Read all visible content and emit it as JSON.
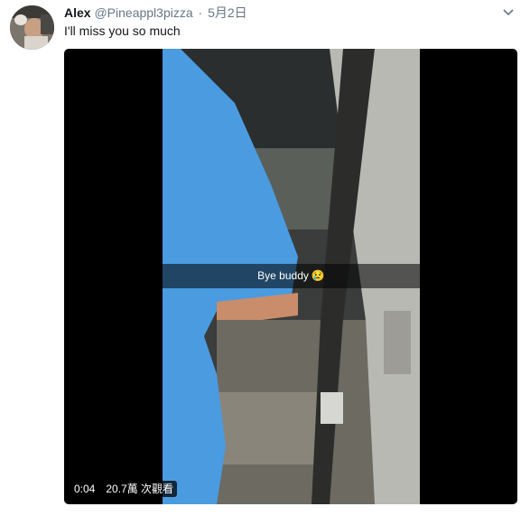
{
  "tweet": {
    "author_name": "Alex",
    "handle": "@Pineappl3pizza",
    "separator": "·",
    "date": "5月2日",
    "text": "I'll miss you so much",
    "caret_icon": "chevron-down-icon"
  },
  "media": {
    "snap_caption": "Bye buddy",
    "snap_emoji": "😢",
    "duration": "0:04",
    "views": "20.7萬 次觀看"
  }
}
